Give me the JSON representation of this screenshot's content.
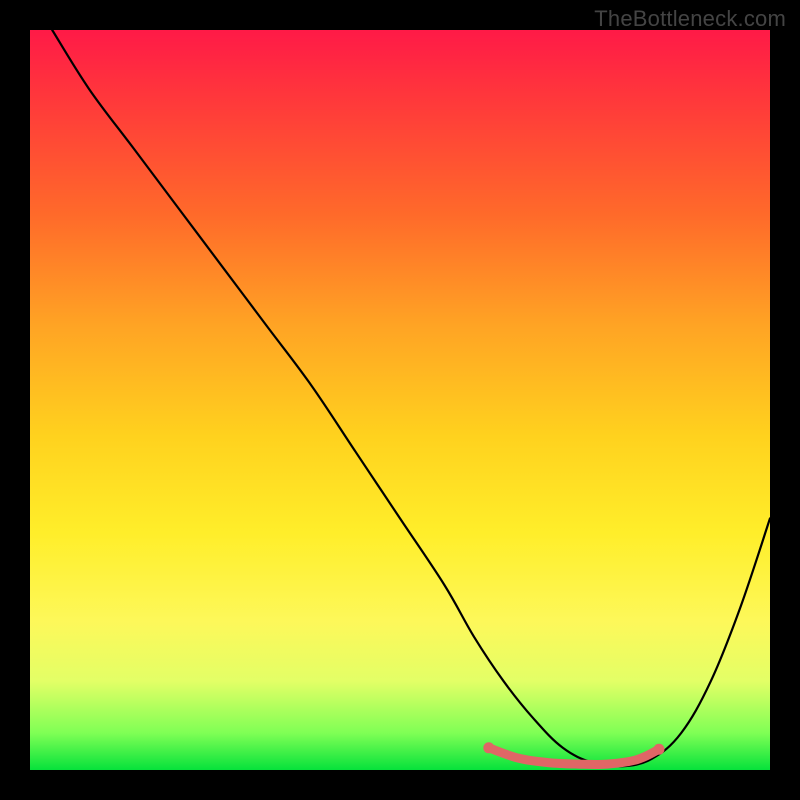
{
  "watermark": "TheBottleneck.com",
  "colors": {
    "page_bg": "#000000",
    "gradient_top": "#ff1a47",
    "gradient_mid": "#ffd21e",
    "gradient_bottom": "#06e23b",
    "curve": "#000000",
    "accent": "#e06666"
  },
  "chart_data": {
    "type": "line",
    "title": "",
    "xlabel": "",
    "ylabel": "",
    "xlim": [
      0,
      100
    ],
    "ylim": [
      0,
      100
    ],
    "grid": false,
    "legend": false,
    "series": [
      {
        "name": "bottleneck-curve",
        "x": [
          3,
          8,
          14,
          20,
          26,
          32,
          38,
          44,
          50,
          56,
          60,
          64,
          68,
          72,
          76,
          80,
          84,
          88,
          92,
          96,
          100
        ],
        "y": [
          100,
          92,
          84,
          76,
          68,
          60,
          52,
          43,
          34,
          25,
          18,
          12,
          7,
          3,
          1,
          0.5,
          1.5,
          5,
          12,
          22,
          34
        ]
      }
    ],
    "accent_segment": {
      "name": "optimal-range",
      "x": [
        62,
        66,
        70,
        74,
        78,
        82,
        85
      ],
      "y": [
        3.0,
        1.6,
        1.0,
        0.8,
        0.8,
        1.4,
        2.8
      ]
    },
    "background_gradient_meaning": "vertical gradient from red (high bottleneck) at top to green (no bottleneck) at bottom"
  }
}
